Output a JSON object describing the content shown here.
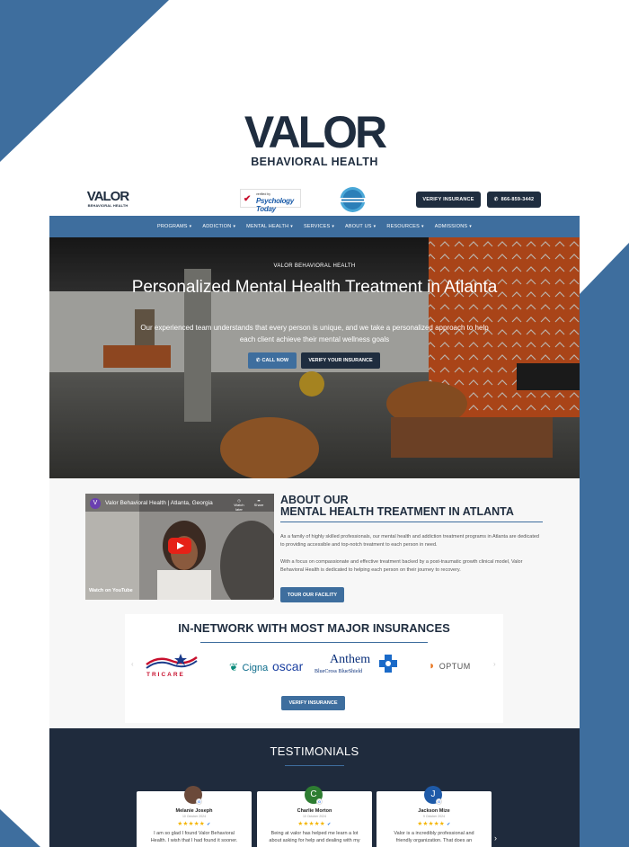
{
  "brand": {
    "name": "VALOR",
    "tagline": "BEHAVIORAL HEALTH",
    "colors": {
      "navy": "#1f2d3f",
      "steel_blue": "#3e6e9e",
      "accent_orange": "#d9581f"
    }
  },
  "topbar": {
    "logo_name": "VALOR",
    "logo_tagline": "BEHAVIORAL HEALTH",
    "psychology_today_small": "verified by",
    "psychology_today_label": "Psychology Today",
    "certified_badge": "Certified",
    "verify_button": "VERIFY INSURANCE",
    "phone_button": "866-859-3442"
  },
  "nav": {
    "items": [
      {
        "label": "PROGRAMS"
      },
      {
        "label": "ADDICTION"
      },
      {
        "label": "MENTAL HEALTH"
      },
      {
        "label": "SERVICES"
      },
      {
        "label": "ABOUT US"
      },
      {
        "label": "RESOURCES"
      },
      {
        "label": "ADMISSIONS"
      }
    ]
  },
  "hero": {
    "overline": "VALOR BEHAVIORAL HEALTH",
    "title": "Personalized Mental Health Treatment in Atlanta",
    "subtitle": "Our experienced team understands that every person is unique, and we take a personalized approach to help each client achieve their mental wellness goals",
    "call_button": "CALL NOW",
    "verify_button": "VERIFY YOUR INSURANCE"
  },
  "about": {
    "video_title": "Valor Behavioral Health | Atlanta, Georgia",
    "video_channel_initial": "V",
    "watch_later": "Watch later",
    "share": "Share",
    "watch_on": "Watch on",
    "youtube": "YouTube",
    "title_line1": "ABOUT OUR",
    "title_line2": "MENTAL HEALTH TREATMENT IN ATLANTA",
    "paragraph1": "As a family of highly skilled professionals, our mental health and addiction treatment programs in Atlanta are dedicated to providing accessible and top-notch treatment to each person in need.",
    "paragraph2": "With a focus on compassionate and effective treatment backed by a post-traumatic growth clinical model, Valor Behavioral Health is dedicated to helping each person on their journey to recovery.",
    "tour_button": "TOUR OUR FACILITY"
  },
  "insurance": {
    "title": "IN-NETWORK WITH MOST MAJOR INSURANCES",
    "logos": [
      "TRICARE",
      "Cigna",
      "oscar",
      "Anthem",
      "BlueCross BlueShield",
      "OPTUM"
    ],
    "verify_button": "VERIFY INSURANCE"
  },
  "testimonials": {
    "title": "TESTIMONIALS",
    "stars": "★★★★★",
    "reviews": [
      {
        "name": "Melanie Joseph",
        "date": "10 October 2024",
        "initial": "",
        "color": "#6b4a3a",
        "text": "I am so glad I found Valor Behavioral Health. I wish that I had found it sooner."
      },
      {
        "name": "Charlie Morton",
        "date": "10 October 2024",
        "initial": "C",
        "color": "#2e7d32",
        "text": "Being at valor has helped me learn a lot about asking for help and dealing with my"
      },
      {
        "name": "Jackson Mize",
        "date": "9 October 2024",
        "initial": "J",
        "color": "#1e5aa8",
        "text": "Valor is a incredibly professional and friendly organization. That does an"
      }
    ]
  }
}
